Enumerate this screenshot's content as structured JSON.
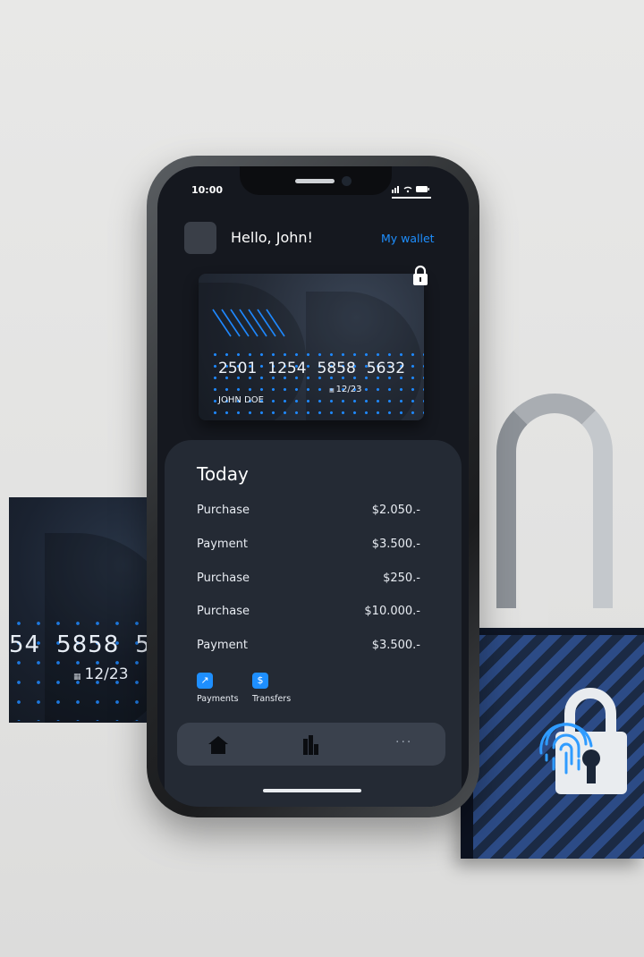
{
  "status_bar": {
    "time": "10:00",
    "icons": "ıll ≈ ▭"
  },
  "header": {
    "greeting": "Hello, John!",
    "wallet_link": "My wallet"
  },
  "card": {
    "number_groups": [
      "2501",
      "1254",
      "5858",
      "5632"
    ],
    "holder": "JOHN DOE",
    "expiry": "12/23"
  },
  "background_card": {
    "number_groups": [
      "54",
      "5858",
      "5"
    ],
    "expiry": "12/23"
  },
  "transactions": {
    "title": "Today",
    "items": [
      {
        "label": "Purchase",
        "amount": "$2.050.-"
      },
      {
        "label": "Payment",
        "amount": "$3.500.-"
      },
      {
        "label": "Purchase",
        "amount": "$250.-"
      },
      {
        "label": "Purchase",
        "amount": "$10.000.-"
      },
      {
        "label": "Payment",
        "amount": "$3.500.-"
      }
    ]
  },
  "quick_actions": [
    {
      "label": "Payments",
      "icon": "arrow-up-right-icon",
      "glyph": "↗"
    },
    {
      "label": "Transfers",
      "icon": "dollar-icon",
      "glyph": "$"
    }
  ],
  "tabbar": {
    "items": [
      {
        "name": "home",
        "icon": "home-icon"
      },
      {
        "name": "stats",
        "icon": "bar-chart-icon"
      },
      {
        "name": "more",
        "icon": "more-icon",
        "glyph": "..."
      }
    ]
  },
  "colors": {
    "accent": "#1e8fff",
    "screen_bg": "#15181f",
    "panel_bg": "#242a34",
    "tabbar_bg": "#3a414d"
  }
}
